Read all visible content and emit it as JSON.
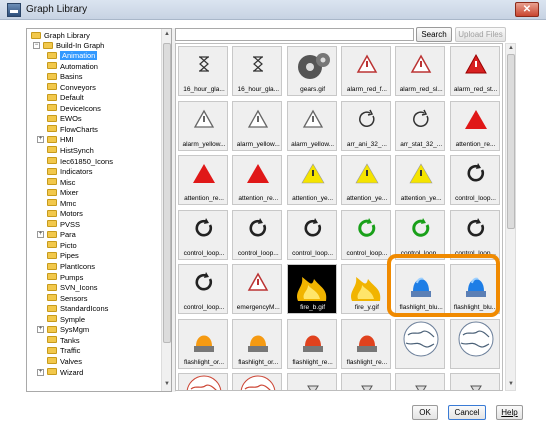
{
  "window": {
    "title": "Graph Library",
    "close_glyph": "✕"
  },
  "tree": {
    "root": "Graph Library",
    "group": "Build-In Graph",
    "items": [
      "Animation",
      "Automation",
      "Basins",
      "Conveyors",
      "Default",
      "DeviceIcons",
      "EWOs",
      "FlowCharts",
      "HMI",
      "HistSynch",
      "Iec61850_Icons",
      "Indicators",
      "Misc",
      "Mixer",
      "Mmc",
      "Motors",
      "PVSS",
      "Para",
      "Picto",
      "Pipes",
      "PlantIcons",
      "Pumps",
      "SVN_Icons",
      "Sensors",
      "StandardIcons",
      "Symple",
      "SysMgm",
      "Tanks",
      "Traffic",
      "Valves",
      "Wizard"
    ],
    "expandable": [
      "HMI",
      "Para",
      "SysMgm",
      "Wizard"
    ],
    "selected": "Animation"
  },
  "toolbar": {
    "search_label": "Search",
    "upload_label": "Upload Files",
    "search_value": ""
  },
  "grid": {
    "tiles": [
      {
        "caption": "16_hour_gla...",
        "icon": "hourglass-icon"
      },
      {
        "caption": "16_hour_gla...",
        "icon": "hourglass-icon"
      },
      {
        "caption": "gears.gif",
        "icon": "gears-icon"
      },
      {
        "caption": "alarm_red_f...",
        "icon": "warning-outline-red-icon"
      },
      {
        "caption": "alarm_red_sl...",
        "icon": "warning-outline-red-icon"
      },
      {
        "caption": "alarm_red_st...",
        "icon": "warning-red-icon"
      },
      {
        "caption": "alarm_yellow...",
        "icon": "warning-outline-icon"
      },
      {
        "caption": "alarm_yellow...",
        "icon": "warning-outline-icon"
      },
      {
        "caption": "alarm_yellow...",
        "icon": "warning-outline-icon"
      },
      {
        "caption": "arr_ani_32_...",
        "icon": "refresh-outline-icon"
      },
      {
        "caption": "arr_stat_32_...",
        "icon": "refresh-outline-icon"
      },
      {
        "caption": "attention_re...",
        "icon": "attention-red-icon"
      },
      {
        "caption": "attention_re...",
        "icon": "attention-red-icon"
      },
      {
        "caption": "attention_re...",
        "icon": "attention-red-icon"
      },
      {
        "caption": "attention_ye...",
        "icon": "attention-yellow-icon"
      },
      {
        "caption": "attention_ye...",
        "icon": "attention-yellow-icon"
      },
      {
        "caption": "attention_ye...",
        "icon": "attention-yellow-icon"
      },
      {
        "caption": "control_loop...",
        "icon": "loop-arrow-icon"
      },
      {
        "caption": "control_loop...",
        "icon": "loop-arrow-icon"
      },
      {
        "caption": "control_loop...",
        "icon": "loop-arrow-icon"
      },
      {
        "caption": "control_loop...",
        "icon": "loop-arrow-icon"
      },
      {
        "caption": "control_loop...",
        "icon": "loop-arrow-green-icon"
      },
      {
        "caption": "control_loop...",
        "icon": "loop-arrow-green-icon"
      },
      {
        "caption": "control_loop...",
        "icon": "loop-arrow-icon"
      },
      {
        "caption": "control_loop...",
        "icon": "loop-arrow-icon"
      },
      {
        "caption": "emergencyM...",
        "icon": "warning-outline-red-icon"
      },
      {
        "caption": "fire_b.gif",
        "icon": "fire-icon"
      },
      {
        "caption": "fire_y.gif",
        "icon": "fire-icon"
      },
      {
        "caption": "flashlight_blu...",
        "icon": "beacon-blue-icon"
      },
      {
        "caption": "flashlight_blu...",
        "icon": "beacon-blue-icon"
      },
      {
        "caption": "flashlight_or...",
        "icon": "beacon-orange-icon"
      },
      {
        "caption": "flashlight_or...",
        "icon": "beacon-orange-icon"
      },
      {
        "caption": "flashlight_re...",
        "icon": "beacon-red-icon"
      },
      {
        "caption": "flashlight_re...",
        "icon": "beacon-red-icon"
      },
      {
        "caption": "",
        "icon": "globe-icon"
      },
      {
        "caption": "",
        "icon": "globe-icon"
      },
      {
        "caption": "",
        "icon": "globe-red-icon"
      },
      {
        "caption": "",
        "icon": "globe-red-icon"
      },
      {
        "caption": "",
        "icon": "filter-icon"
      },
      {
        "caption": "",
        "icon": "filter-icon"
      },
      {
        "caption": "",
        "icon": "filter-icon"
      },
      {
        "caption": "",
        "icon": "filter-icon"
      }
    ]
  },
  "footer": {
    "ok_label": "OK",
    "cancel_label": "Cancel",
    "help_label": "Help"
  },
  "colors": {
    "selection": "#3399ff",
    "highlight": "#f08a00",
    "beacon_blue": "#1e7ee6"
  }
}
